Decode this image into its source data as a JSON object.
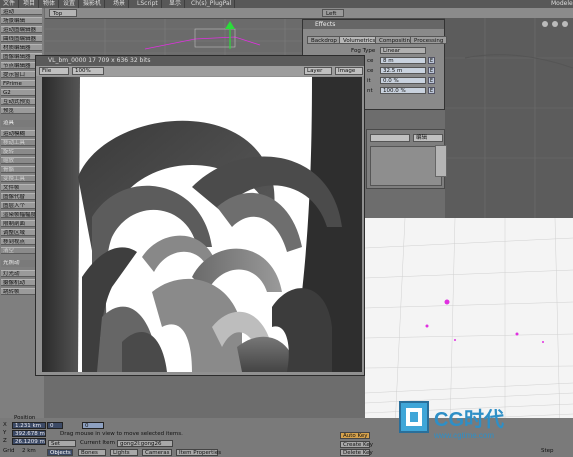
{
  "top_tabs": [
    "文件",
    "项目",
    "物体",
    "设置",
    "摄影机",
    "场景",
    "LScript",
    "显示",
    "Ch(s)_PlugPal"
  ],
  "top_right": "Modeler",
  "sidebar": {
    "items": [
      {
        "label": "运动",
        "style": "normal"
      },
      {
        "label": "场景编辑",
        "style": "normal"
      },
      {
        "label": "运动图编辑器",
        "style": "normal"
      },
      {
        "label": "曲线图编辑器",
        "style": "normal"
      },
      {
        "label": "材质编辑器",
        "style": "normal"
      },
      {
        "label": "图像编辑器",
        "style": "normal"
      },
      {
        "label": "节点编辑器",
        "style": "normal"
      },
      {
        "label": "提示窗口",
        "style": "normal"
      },
      {
        "label": "FPrime",
        "style": "normal"
      },
      {
        "label": "G2",
        "style": "normal"
      },
      {
        "label": "互动式预览",
        "style": "normal"
      },
      {
        "label": "预览",
        "style": "normal"
      },
      {
        "label": "道具",
        "style": "head"
      },
      {
        "label": "运动模糊",
        "style": "normal"
      },
      {
        "label": "移动工具",
        "style": "dim"
      },
      {
        "label": "旋转",
        "style": "dim"
      },
      {
        "label": "缩放",
        "style": "dim"
      },
      {
        "label": "骨骼",
        "style": "dim"
      },
      {
        "label": "变换工具",
        "style": "dim"
      },
      {
        "label": "文件帧",
        "style": "normal"
      },
      {
        "label": "图像代替",
        "style": "normal"
      },
      {
        "label": "图层入个",
        "style": "normal"
      },
      {
        "label": "渲染帧幅幅度",
        "style": "normal"
      },
      {
        "label": "限制剖面",
        "style": "normal"
      },
      {
        "label": "调整区域",
        "style": "normal"
      },
      {
        "label": "移到视点",
        "style": "normal"
      },
      {
        "label": "清空",
        "style": "dim"
      },
      {
        "label": "光照动",
        "style": "head"
      },
      {
        "label": "灯光动",
        "style": "normal"
      },
      {
        "label": "摄像机动",
        "style": "normal"
      },
      {
        "label": "跳转帧",
        "style": "normal"
      }
    ]
  },
  "viewport": {
    "view_label": "Top",
    "left_label": "Left",
    "right_icons": [
      "move-icon",
      "zoom-icon",
      "rotate-icon"
    ]
  },
  "effects_window": {
    "title": "Effects",
    "tabs": [
      "Backdrop",
      "Volumetrics",
      "Compositing",
      "Processing"
    ],
    "active_tab": "Volumetrics",
    "fog_type_label": "Fog Type",
    "fog_type_value": "Linear",
    "rows": [
      {
        "label": "ce",
        "value": "8 m"
      },
      {
        "label": "ce",
        "value": "32.5 m"
      },
      {
        "label": "it",
        "value": "0.0 %"
      },
      {
        "label": "nt",
        "value": "100.0 %"
      }
    ],
    "env_button": "E"
  },
  "mid_panel": {
    "dropdown_left": "",
    "dropdown_right": "编辑"
  },
  "image_viewer": {
    "title": "VL_bm_0000 17  709 x 636  32 bits",
    "file_menu": "File",
    "zoom": "100%",
    "layer_menu": "Layer",
    "image_menu": "Image"
  },
  "bottom_bar": {
    "position_label": "Position",
    "x_label": "X",
    "x_value": "1.231 km",
    "y_label": "Y",
    "y_value": "392.678 m",
    "z_label": "Z",
    "z_value": "26.1209 m",
    "grid_label": "Grid",
    "grid_value": "2 km",
    "frame_value": "0",
    "frame_value2": "0",
    "status_text": "Drag mouse in view to move selected items.",
    "set_button": "Set",
    "current_item_label": "Current Item",
    "current_item_value": "gong2l:gong26",
    "objects_button": "Objects",
    "bones_button": "Bones",
    "lights_button": "Lights",
    "cameras_button": "Cameras",
    "properties_button": "Item Properties",
    "auto_key_button": "Auto Key",
    "create_key_button": "Create Key",
    "delete_key_button": "Delete Key",
    "step_label": "Step",
    "step_value": "1"
  },
  "watermark": {
    "brand": "CG时代",
    "url": "www.cgtime.com"
  },
  "colors": {
    "accent_green": "#2bdc3a",
    "accent_magenta": "#e030e0",
    "field_blue": "#3c4a66"
  }
}
